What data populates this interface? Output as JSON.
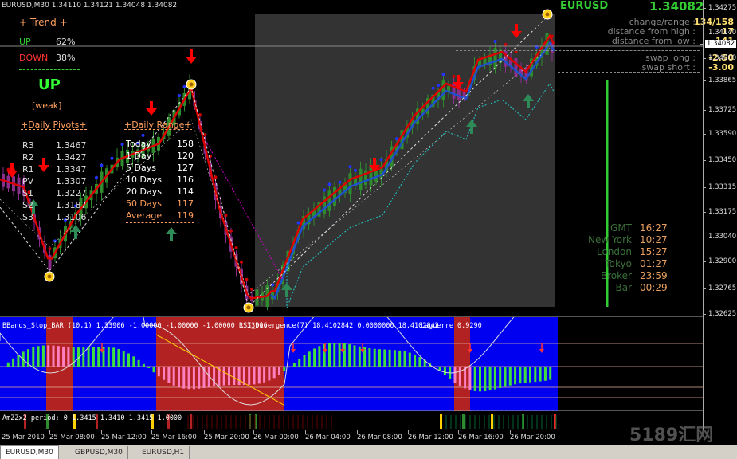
{
  "header": {
    "info": "EURUSD,M30 1.34110 1.34121 1.34048 1.34082"
  },
  "trend": {
    "title": "+ Trend +",
    "up_label": "UP",
    "up_pct": "62%",
    "down_label": "DOWN",
    "down_pct": "38%",
    "signal": "UP",
    "strength": "[weak]"
  },
  "pivots": {
    "title": "+Daily Pivots+",
    "rows": [
      {
        "name": "R3",
        "value": "1.3467"
      },
      {
        "name": "R2",
        "value": "1.3427"
      },
      {
        "name": "R1",
        "value": "1.3347"
      },
      {
        "name": "PV",
        "value": "1.3307"
      },
      {
        "name": "S1",
        "value": "1.3227"
      },
      {
        "name": "S2",
        "value": "1.3187"
      },
      {
        "name": "S3",
        "value": "1.3106"
      }
    ]
  },
  "range": {
    "title": "+Daily Range+",
    "rows": [
      {
        "name": "Today",
        "value": "158"
      },
      {
        "name": "1 Day",
        "value": "120"
      },
      {
        "name": "5 Days",
        "value": "127"
      },
      {
        "name": "10 Days",
        "value": "116"
      },
      {
        "name": "20 Days",
        "value": "114"
      },
      {
        "name": "50 Days",
        "value": "117"
      }
    ],
    "avg_label": "Average",
    "avg_value": "119"
  },
  "symbol_box": {
    "symbol": "EURUSD",
    "price": "1.34082",
    "rows": [
      {
        "label": "change/range :",
        "value": "134/158"
      },
      {
        "label": "distance from high :",
        "value": "17"
      },
      {
        "label": "distance from low :",
        "value": "141"
      },
      {
        "label": "swap long :",
        "value": "-2.50"
      },
      {
        "label": "swap short :",
        "value": "-3.00"
      }
    ]
  },
  "clocks": [
    {
      "label": "GMT",
      "time": "16:27"
    },
    {
      "label": "New York",
      "time": "10:27"
    },
    {
      "label": "London",
      "time": "15:27"
    },
    {
      "label": "Tokyo",
      "time": "01:27"
    },
    {
      "label": "Broker",
      "time": "23:59"
    },
    {
      "label": "Bar",
      "time": "00:29"
    }
  ],
  "indicator": {
    "label1": "BBands_Stop_BAR (10,1) 1.33906 -1.00000 -1.00000 -1.00000 1.33906",
    "label2": "RSI_Divergence(7) 18.4102842 0.0000000 18.4102842",
    "label3": "Laguerre 0.9290",
    "scale": [
      "1",
      "0.85",
      "0.75",
      "0",
      "0.25",
      "0.15",
      "0"
    ]
  },
  "zigzag": {
    "label": "AmZZx2 period: 0 1.3415 1.3410 1.3415 1.0000"
  },
  "price_axis": [
    "1.34275",
    "1.34140",
    "1.34082",
    "1.34000",
    "1.33865",
    "1.33725",
    "1.33590",
    "1.33450",
    "1.33315",
    "1.33175",
    "1.33040",
    "1.32900",
    "1.32765",
    "1.32625"
  ],
  "time_axis": [
    "25 Mar 2010",
    "25 Mar 08:00",
    "25 Mar 12:00",
    "25 Mar 16:00",
    "25 Mar 20:00",
    "26 Mar 00:00",
    "26 Mar 04:00",
    "26 Mar 08:00",
    "26 Mar 12:00",
    "26 Mar 16:00",
    "26 Mar 20:00"
  ],
  "tabs": [
    "EURUSD,M30",
    "GBPUSD,M30",
    "EURUSD,H1"
  ],
  "watermark": "5189汇网",
  "colors": {
    "bull": "#2e8b2e",
    "bear": "#8b2e8b",
    "up_arrow": "#2e8b57",
    "down_arrow": "#ff0000",
    "ind_blue": "#0000ff",
    "ind_red": "#b22222"
  }
}
